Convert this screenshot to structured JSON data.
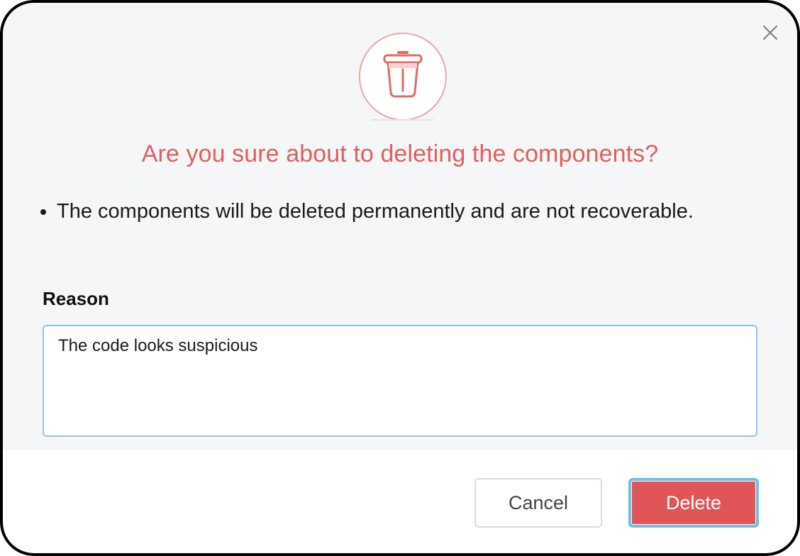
{
  "dialog": {
    "close_icon": "close-icon",
    "hero_icon": "trash-icon",
    "title": "Are you sure about to deleting the components?",
    "warnings": [
      "The components will be deleted permanently and are not recoverable."
    ],
    "reason": {
      "label": "Reason",
      "value": "The code looks suspicious"
    },
    "buttons": {
      "cancel_label": "Cancel",
      "delete_label": "Delete"
    }
  },
  "colors": {
    "title": "#e05f5f",
    "delete_button": "#e05557",
    "focus_ring": "#6fbee4",
    "body_background": "#f5f6f8",
    "icon_ring": "#e8aaa4"
  }
}
